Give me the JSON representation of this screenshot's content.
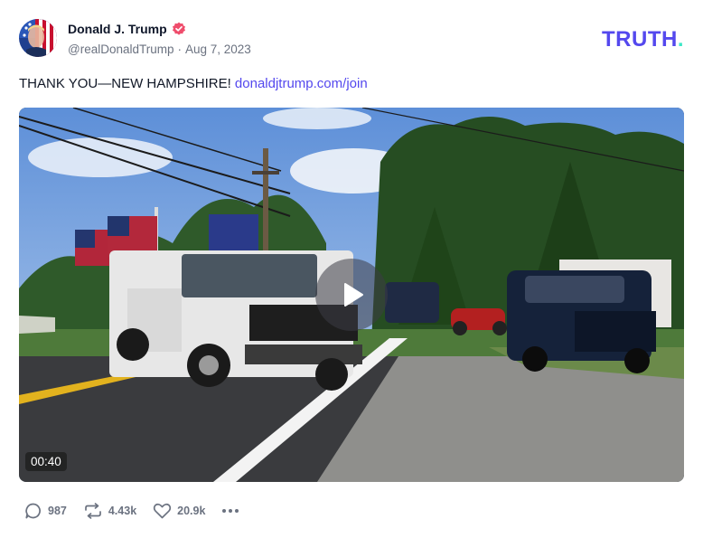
{
  "author": {
    "display_name": "Donald J. Trump",
    "handle": "@realDonaldTrump",
    "separator": "·",
    "date": "Aug 7, 2023",
    "verified": true
  },
  "brand": {
    "logo_text": "TRUTH",
    "logo_dot": ".",
    "color": "#5448ee",
    "dot_color": "#3ee8c7"
  },
  "post": {
    "text": "THANK YOU—NEW HAMPSHIRE!",
    "link_text": "donaldjtrump.com/join"
  },
  "media": {
    "type": "video",
    "duration": "00:40",
    "play_icon": "play-icon"
  },
  "actions": {
    "replies": "987",
    "retruths": "4.43k",
    "likes": "20.9k",
    "reply_icon": "comment-icon",
    "retruth_icon": "retruth-icon",
    "like_icon": "heart-icon",
    "more_icon": "more-icon"
  },
  "colors": {
    "verified_badge": "#ef4d6c",
    "link": "#5448ee",
    "muted_text": "#6b7280"
  }
}
